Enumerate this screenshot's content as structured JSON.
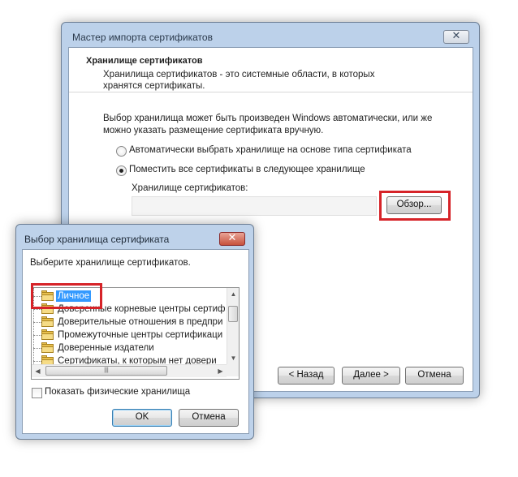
{
  "wizard": {
    "title": "Мастер импорта сертификатов",
    "header_title": "Хранилище сертификатов",
    "header_desc": "Хранилища сертификатов - это системные области, в которых хранятся сертификаты.",
    "intro": "Выбор хранилища может быть произведен Windows автоматически, или же можно указать размещение сертификата вручную.",
    "radio_auto": "Автоматически выбрать хранилище на основе типа сертификата",
    "radio_manual": "Поместить все сертификаты в следующее хранилище",
    "store_label": "Хранилище сертификатов:",
    "store_value": "",
    "browse_label": "Обзор...",
    "back_label": "< Назад",
    "next_label": "Далее >",
    "cancel_label": "Отмена",
    "selected_option": "manual"
  },
  "dialog": {
    "title": "Выбор хранилища сертификата",
    "prompt": "Выберите хранилище сертификатов.",
    "stores": [
      "Личное",
      "Доверенные корневые центры сертиф",
      "Доверительные отношения в предпри",
      "Промежуточные центры сертификаци",
      "Доверенные издатели",
      "Сертификаты, к которым нет довери"
    ],
    "selected_store": "Личное",
    "show_physical_label": "Показать физические хранилища",
    "show_physical_checked": false,
    "ok_label": "OK",
    "cancel_label": "Отмена"
  },
  "colors": {
    "highlight": "#d62328",
    "selection": "#3399ff",
    "window_frame": "#bcd1ea"
  }
}
